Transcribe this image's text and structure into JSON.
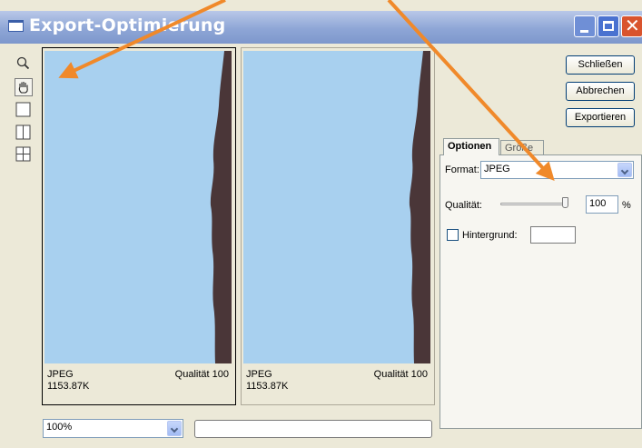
{
  "window": {
    "title": "Export-Optimierung"
  },
  "toolbar": {
    "tools": [
      {
        "icon": "magnifier-icon"
      },
      {
        "icon": "hand-icon"
      },
      {
        "icon": "single-view-icon"
      },
      {
        "icon": "two-up-view-icon"
      },
      {
        "icon": "four-up-view-icon"
      }
    ]
  },
  "preview": {
    "left": {
      "format": "JPEG",
      "quality": "Qualität 100",
      "size": "1153.87K"
    },
    "right": {
      "format": "JPEG",
      "quality": "Qualität 100",
      "size": "1153.87K"
    }
  },
  "zoom": {
    "value": "100%"
  },
  "buttons": {
    "close": "Schließen",
    "cancel": "Abbrechen",
    "export": "Exportieren"
  },
  "tabs": {
    "options": "Optionen",
    "size": "Größe"
  },
  "options": {
    "format_label": "Format:",
    "format_value": "JPEG",
    "quality_label": "Qualität:",
    "quality_value": "100",
    "quality_unit": "%",
    "quality_slider_fraction": 1.0,
    "background_label": "Hintergrund:",
    "background_checked": false
  },
  "colors": {
    "sky": "#a8d0ef",
    "arrow": "#f0892a",
    "edge": "#4a3638"
  }
}
